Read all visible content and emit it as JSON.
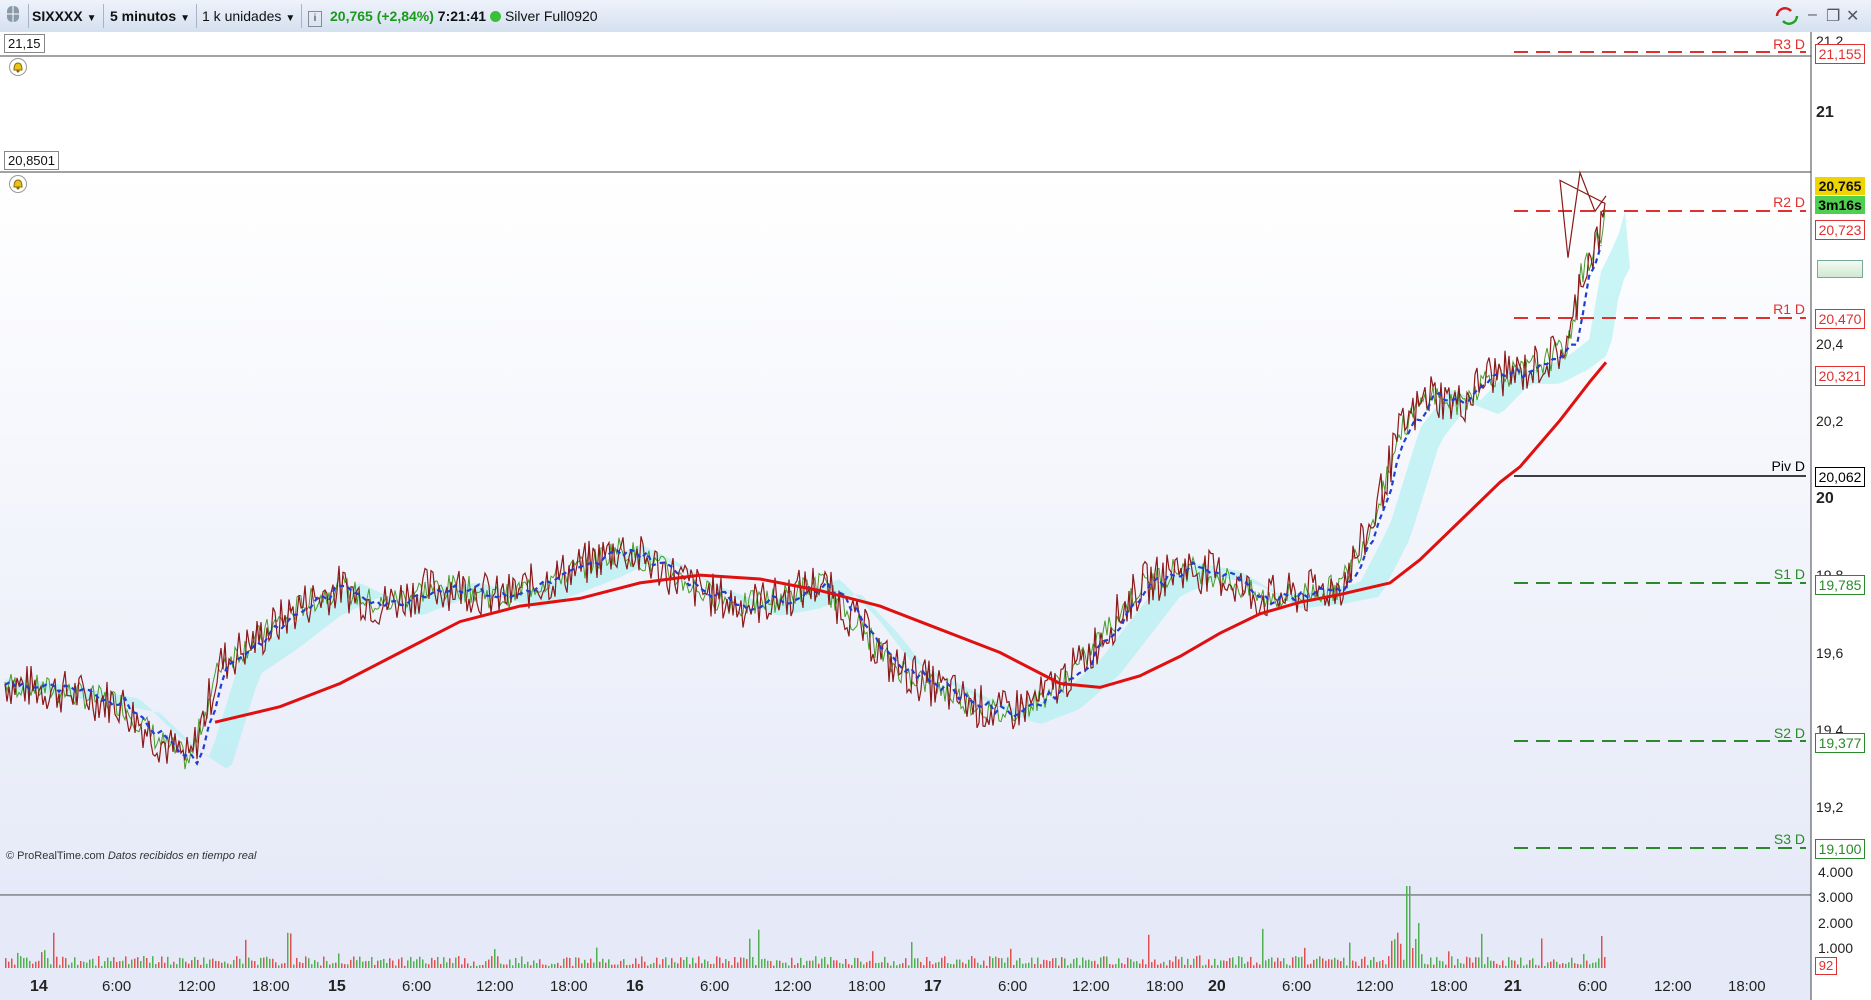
{
  "toolbar": {
    "symbol": "SIXXXX",
    "timeframe": "5 minutos",
    "units": "1 k unidades",
    "info_icon": "info-icon",
    "price_change": "20,765 (+2,84%)",
    "time": "7:21:41",
    "status_color": "#3bbf3b",
    "instrument": "Silver Full0920"
  },
  "upper_panel": {
    "value": "21,15",
    "axis_labels": [
      "21,2",
      "21"
    ]
  },
  "main_panel": {
    "value": "20,8501",
    "axis_labels": [
      "20,4",
      "20,2",
      "20",
      "19,8",
      "19,6",
      "19,4",
      "19,2"
    ],
    "current_price": "20,765",
    "countdown": "3m16s",
    "credit": "© ProRealTime.com",
    "credit_note": "Datos recibidos en tiempo real"
  },
  "pivots": [
    {
      "label": "R3 D",
      "value": "21,155",
      "color": "#e03030"
    },
    {
      "label": "R2 D",
      "value": "20,723",
      "color": "#e03030"
    },
    {
      "label": "R1 D",
      "value": "20,470",
      "color": "#e03030"
    },
    {
      "label": "",
      "value": "20,321",
      "color": "#e03030"
    },
    {
      "label": "Piv D",
      "value": "20,062",
      "color": "#000000"
    },
    {
      "label": "S1 D",
      "value": "19,785",
      "color": "#2a8a2a"
    },
    {
      "label": "S2 D",
      "value": "19,377",
      "color": "#2a8a2a"
    },
    {
      "label": "S3 D",
      "value": "19,100",
      "color": "#2a8a2a"
    }
  ],
  "volume_panel": {
    "axis_labels": [
      "4.000",
      "3.000",
      "2.000",
      "1.000"
    ],
    "current": "92"
  },
  "x_axis": [
    {
      "t": "14",
      "bold": true
    },
    {
      "t": "6:00"
    },
    {
      "t": "12:00"
    },
    {
      "t": "18:00"
    },
    {
      "t": "15",
      "bold": true
    },
    {
      "t": "6:00"
    },
    {
      "t": "12:00"
    },
    {
      "t": "18:00"
    },
    {
      "t": "16",
      "bold": true
    },
    {
      "t": "6:00"
    },
    {
      "t": "12:00"
    },
    {
      "t": "18:00"
    },
    {
      "t": "17",
      "bold": true
    },
    {
      "t": "6:00"
    },
    {
      "t": "12:00"
    },
    {
      "t": "18:00"
    },
    {
      "t": "20",
      "bold": true
    },
    {
      "t": "6:00"
    },
    {
      "t": "12:00"
    },
    {
      "t": "18:00"
    },
    {
      "t": "21",
      "bold": true
    },
    {
      "t": "6:00"
    },
    {
      "t": "12:00"
    },
    {
      "t": "18:00"
    }
  ],
  "colors": {
    "price_line": "#8b1a1a",
    "ma_line": "#e01010",
    "dash_line": "#1f3fd0",
    "cloud": "#a8f0f0"
  }
}
